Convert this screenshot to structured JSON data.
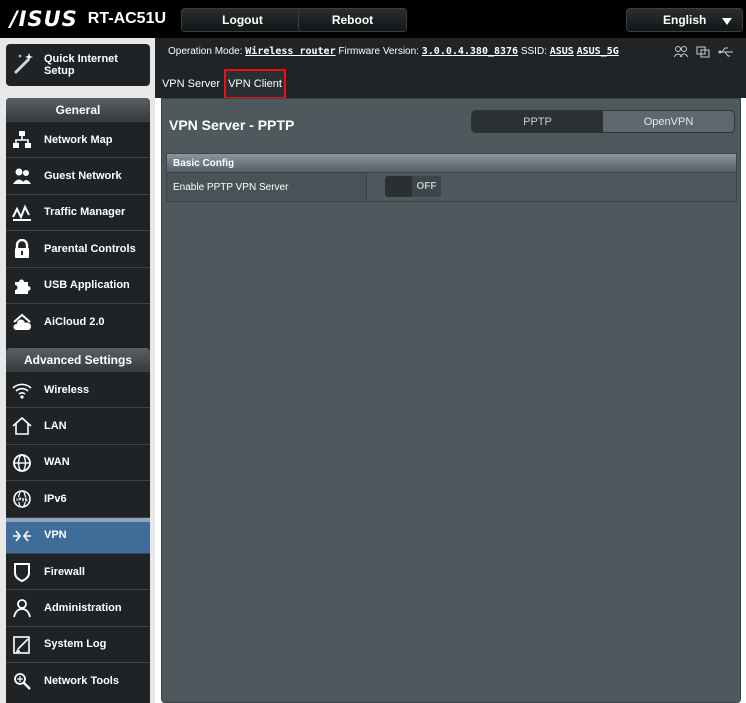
{
  "header": {
    "brand": "/ISUS",
    "model": "RT-AC51U",
    "logout_label": "Logout",
    "reboot_label": "Reboot",
    "language": "English"
  },
  "quick_setup": {
    "label": "Quick Internet\nSetup"
  },
  "general": {
    "title": "General",
    "items": [
      {
        "label": "Network Map",
        "icon": "network-map-icon"
      },
      {
        "label": "Guest Network",
        "icon": "guest-network-icon"
      },
      {
        "label": "Traffic Manager",
        "icon": "traffic-manager-icon"
      },
      {
        "label": "Parental Controls",
        "icon": "lock-icon"
      },
      {
        "label": "USB Application",
        "icon": "puzzle-icon"
      },
      {
        "label": "AiCloud 2.0",
        "icon": "cloud-home-icon"
      }
    ]
  },
  "advanced": {
    "title": "Advanced Settings",
    "active_index": 4,
    "items": [
      {
        "label": "Wireless",
        "icon": "wifi-icon"
      },
      {
        "label": "LAN",
        "icon": "home-icon"
      },
      {
        "label": "WAN",
        "icon": "globe-icon"
      },
      {
        "label": "IPv6",
        "icon": "ipv6-globe-icon"
      },
      {
        "label": "VPN",
        "icon": "vpn-icon"
      },
      {
        "label": "Firewall",
        "icon": "shield-icon"
      },
      {
        "label": "Administration",
        "icon": "user-icon"
      },
      {
        "label": "System Log",
        "icon": "log-icon"
      },
      {
        "label": "Network Tools",
        "icon": "tools-icon"
      }
    ]
  },
  "status": {
    "op_mode_label": "Operation Mode:",
    "op_mode_value": "Wireless router",
    "fw_label": "Firmware Version:",
    "fw_value": "3.0.0.4.380_8376",
    "ssid_label": "SSID:",
    "ssid_1": "ASUS",
    "ssid_2": "ASUS_5G"
  },
  "tabs": {
    "server": "VPN Server",
    "client": "VPN Client"
  },
  "panel": {
    "title": "VPN Server - PPTP",
    "protocols": [
      "PPTP",
      "OpenVPN"
    ],
    "section": "Basic Config",
    "row_label": "Enable PPTP VPN Server",
    "toggle_state": "OFF"
  },
  "colors": {
    "header_bg": "#000000",
    "panel_bg": "#4d595d",
    "active_menu": "#3f6d9a",
    "highlight_border": "#ee1111"
  }
}
